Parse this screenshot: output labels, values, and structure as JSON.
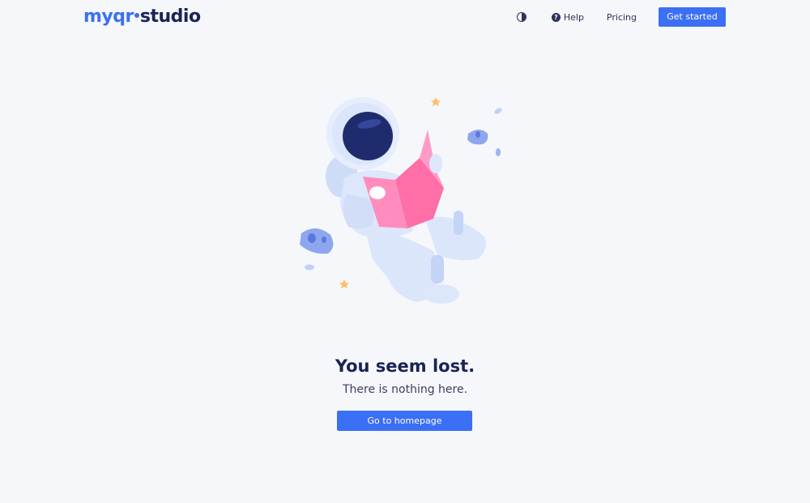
{
  "logo": {
    "part_a": "myqr",
    "part_b": "studio"
  },
  "nav": {
    "theme_toggle_icon": "contrast-icon",
    "help_icon": "question-circle-icon",
    "help_label": "Help",
    "pricing_label": "Pricing",
    "cta_label": "Get started"
  },
  "illustration": {
    "subject": "astronaut-reading-map-icon"
  },
  "content": {
    "title": "You seem lost.",
    "subtitle": "There is nothing here.",
    "button_label": "Go to homepage"
  },
  "colors": {
    "background": "#f5f7fb",
    "primary": "#3b6ff5",
    "dark_text": "#1a2354",
    "map_pink": "#ff7eb3"
  }
}
